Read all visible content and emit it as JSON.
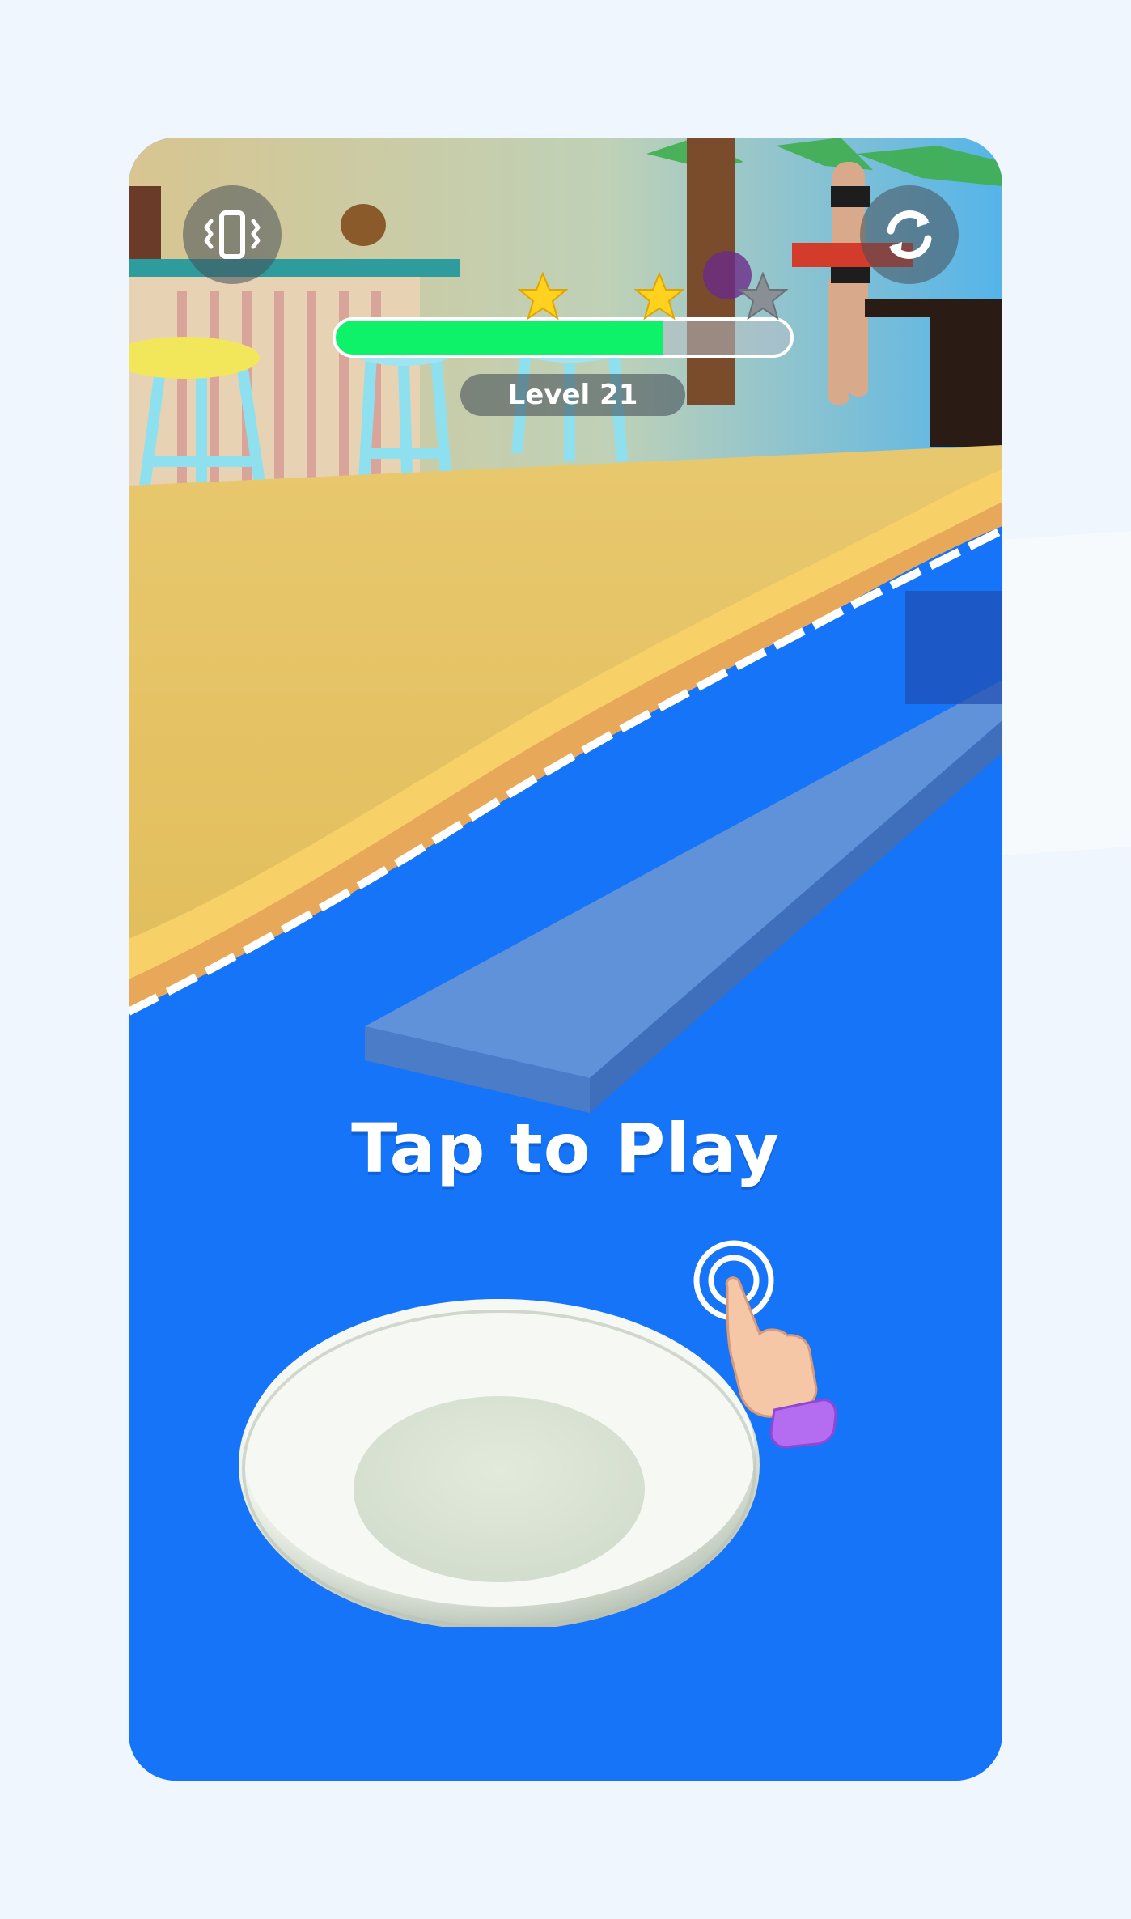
{
  "hud": {
    "vibration_button": {
      "icon": "vibration-phone-icon"
    },
    "restart_button": {
      "icon": "restart-icon"
    },
    "progress": {
      "fraction": 0.72
    },
    "stars": [
      {
        "icon": "star-icon",
        "state": "earned",
        "color": "#ffd21f"
      },
      {
        "icon": "star-icon",
        "state": "earned",
        "color": "#ffd21f"
      },
      {
        "icon": "star-icon",
        "state": "empty",
        "color": "#8a8f96"
      }
    ],
    "level_label": "Level 21"
  },
  "prompt": {
    "text": "Tap to Play"
  },
  "tutorial": {
    "hand_icon": "tap-hand-icon"
  },
  "game_object": {
    "name": "plate"
  },
  "colors": {
    "water": "#1574f8",
    "sand": "#efc966",
    "progress_fill": "#0ef26a",
    "background": "#eff6fd"
  }
}
